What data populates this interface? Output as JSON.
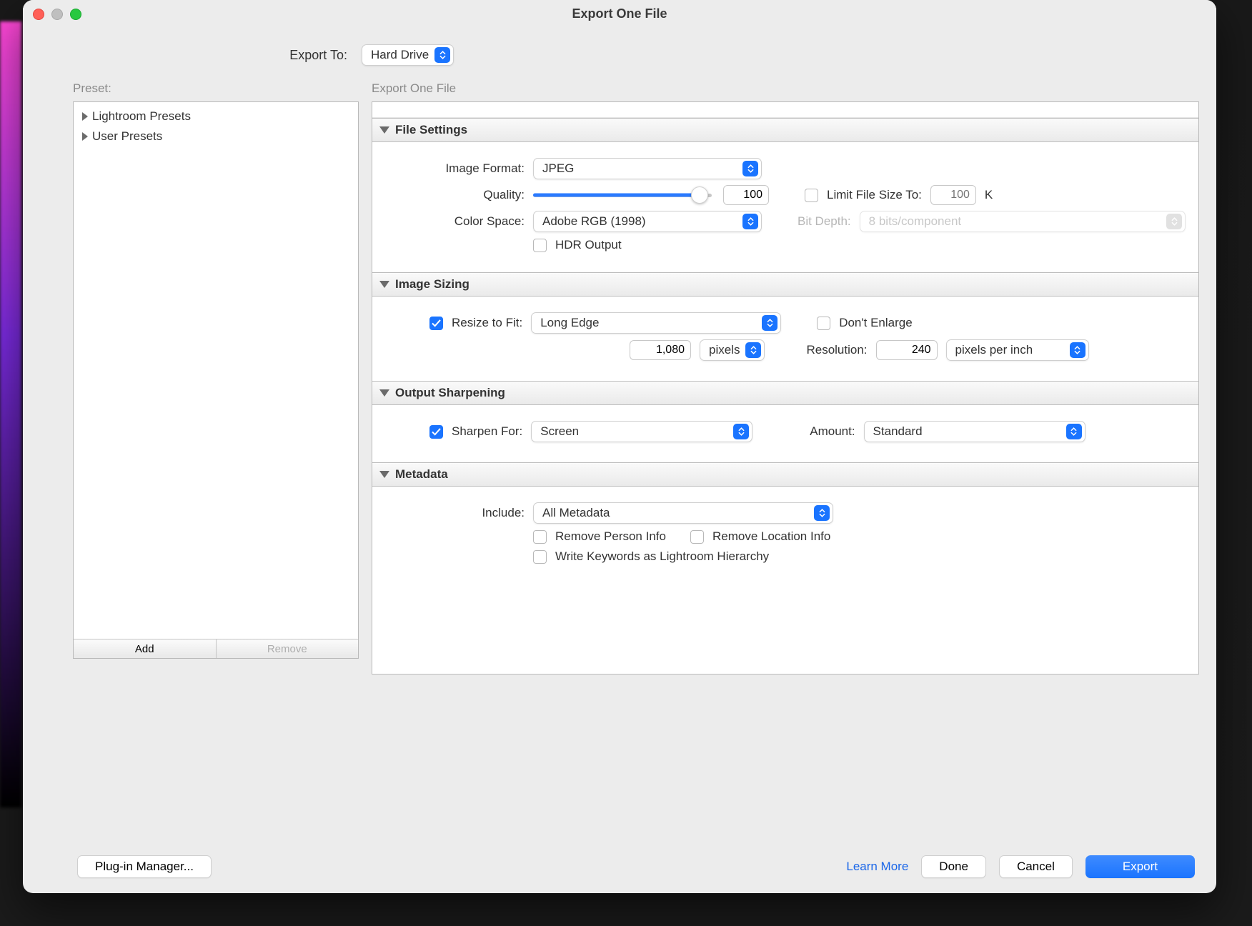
{
  "window": {
    "title": "Export One File"
  },
  "exportTo": {
    "label": "Export To:",
    "value": "Hard Drive"
  },
  "leftColumn": {
    "header": "Preset:",
    "items": [
      "Lightroom Presets",
      "User Presets"
    ],
    "add": "Add",
    "remove": "Remove"
  },
  "rightHeader": "Export One File",
  "sections": {
    "fileSettings": {
      "title": "File Settings",
      "imageFormatLabel": "Image Format:",
      "imageFormatValue": "JPEG",
      "qualityLabel": "Quality:",
      "qualityValue": "100",
      "qualityFillPct": 93,
      "limitFileSizeLabel": "Limit File Size To:",
      "limitFileSizeValue": "100",
      "limitFileSizeUnit": "K",
      "colorSpaceLabel": "Color Space:",
      "colorSpaceValue": "Adobe RGB (1998)",
      "bitDepthLabel": "Bit Depth:",
      "bitDepthValue": "8 bits/component",
      "hdrOutputLabel": "HDR Output"
    },
    "imageSizing": {
      "title": "Image Sizing",
      "resizeToFitLabel": "Resize to Fit:",
      "resizeToFitValue": "Long Edge",
      "dontEnlargeLabel": "Don't Enlarge",
      "sizeValue": "1,080",
      "sizeUnit": "pixels",
      "resolutionLabel": "Resolution:",
      "resolutionValue": "240",
      "resolutionUnit": "pixels per inch"
    },
    "outputSharpening": {
      "title": "Output Sharpening",
      "sharpenForLabel": "Sharpen For:",
      "sharpenForValue": "Screen",
      "amountLabel": "Amount:",
      "amountValue": "Standard"
    },
    "metadata": {
      "title": "Metadata",
      "includeLabel": "Include:",
      "includeValue": "All Metadata",
      "removePersonLabel": "Remove Person Info",
      "removeLocationLabel": "Remove Location Info",
      "writeKeywordsLabel": "Write Keywords as Lightroom Hierarchy"
    }
  },
  "footer": {
    "pluginManager": "Plug-in Manager...",
    "learnMore": "Learn More",
    "done": "Done",
    "cancel": "Cancel",
    "export": "Export"
  }
}
